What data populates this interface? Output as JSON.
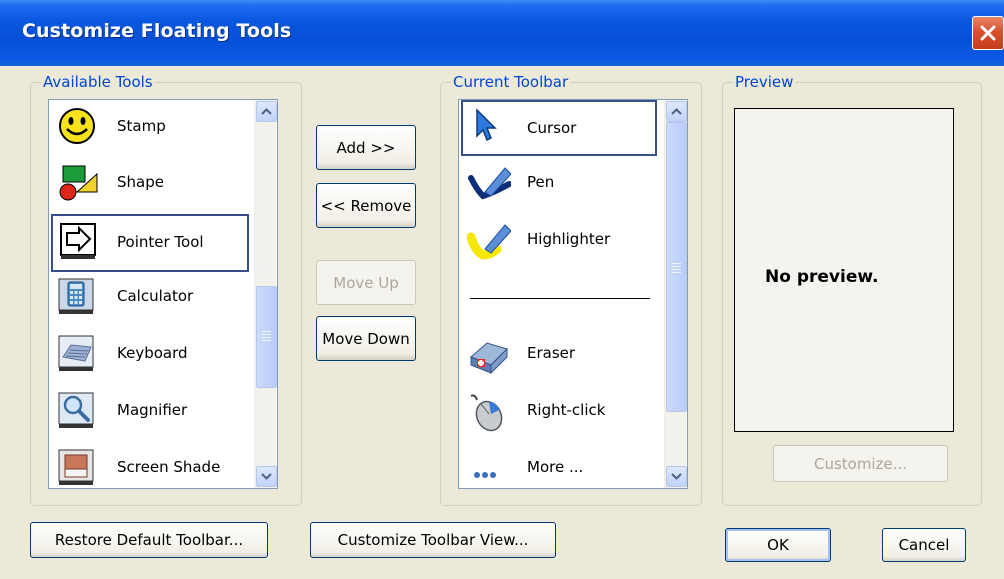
{
  "window": {
    "title": "Customize Floating Tools"
  },
  "available": {
    "label": "Available Tools",
    "items": [
      {
        "label": "Stamp",
        "icon": "smiley-stamp-icon"
      },
      {
        "label": "Shape",
        "icon": "shape-icon"
      },
      {
        "label": "Pointer Tool",
        "icon": "pointer-arrow-icon"
      },
      {
        "label": "Calculator",
        "icon": "calculator-icon"
      },
      {
        "label": "Keyboard",
        "icon": "keyboard-icon"
      },
      {
        "label": "Magnifier",
        "icon": "magnifier-icon"
      },
      {
        "label": "Screen Shade",
        "icon": "screen-shade-icon"
      }
    ],
    "selected": "Pointer Tool"
  },
  "buttons": {
    "add": "Add >>",
    "remove": "<< Remove",
    "move_up": "Move Up",
    "move_down": "Move Down",
    "restore": "Restore Default Toolbar...",
    "customize_view": "Customize Toolbar View...",
    "ok": "OK",
    "cancel": "Cancel",
    "customize": "Customize..."
  },
  "current": {
    "label": "Current Toolbar",
    "items": [
      {
        "label": "Cursor",
        "icon": "cursor-arrow-icon"
      },
      {
        "label": "Pen",
        "icon": "pen-icon"
      },
      {
        "label": "Highlighter",
        "icon": "highlighter-icon"
      },
      {
        "label": "Eraser",
        "icon": "eraser-icon"
      },
      {
        "label": "Right-click",
        "icon": "mouse-right-click-icon"
      },
      {
        "label": "More ...",
        "icon": "more-dots-icon"
      }
    ],
    "selected": "Cursor"
  },
  "preview": {
    "label": "Preview",
    "text": "No preview."
  }
}
